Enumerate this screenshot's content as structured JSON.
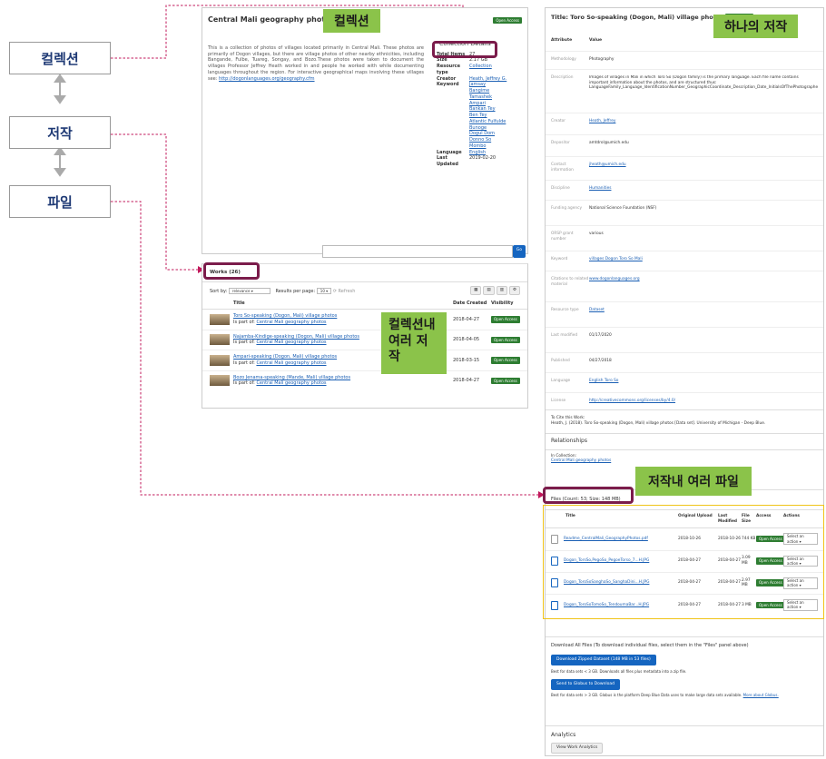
{
  "labels": {
    "left_collection": "컬렉션",
    "left_work": "저작",
    "left_file": "파일",
    "tag_collection": "컬렉션",
    "tag_single_work": "하나의 저작",
    "tag_works_in_collection": "컬렉션내 여러 저작",
    "tag_files_in_work": "저작내 여러 파일"
  },
  "collection": {
    "title": "Central Mali geography photos",
    "badge": "Open Access",
    "description": "This is a collection of photos of villages located primarily in Central Mali. These photos are primarily of Dogon villages, but there are village photos of other nearby ethnicities, including Bangande, Fulbe, Tuareg, Songay, and Bozo.These photos were taken to document the villages Professor Jeffrey Heath worked in and people he worked with while documenting languages throughout the region. For interactive geographical maps involving these villages see:",
    "description_link": "http://dogonlanguages.org/geography.cfm",
    "details_title": "Collection Details",
    "details": {
      "total_items_k": "Total Items",
      "total_items_v": "27",
      "size_k": "Size",
      "size_v": "2.17 GB",
      "rtype_k": "Resource type",
      "rtype_v": "Collection",
      "creator_k": "Creator",
      "creator_v": "Heath, Jeffrey G.",
      "keyword_k": "Keyword",
      "keywords": [
        "Jamsay",
        "Bangime",
        "Tamashek",
        "Ampari",
        "Bankan Tey",
        "Ben Tey",
        "Atlantic Fulfulde",
        "Bunoge",
        "Dogul Dom",
        "Donno So",
        "Mombo"
      ],
      "language_k": "Language",
      "language_v": "English",
      "updated_k": "Last Updated",
      "updated_v": "2019-02-20"
    },
    "search_btn": "Go",
    "works_header": "Works (26)",
    "sort_label": "Sort by:",
    "sort_value": "relevance",
    "rpp_label": "Results per page:",
    "rpp_value": "10",
    "refresh": "Refresh",
    "cols": {
      "title": "Title",
      "date": "Date Created",
      "vis": "Visibility"
    },
    "part_of": "Is part of:",
    "works": [
      {
        "title": "Toro So-speaking (Dogon, Mali) village photos",
        "parent": "Central Mali geography photos",
        "date": "2018-04-27",
        "vis": "Open Access"
      },
      {
        "title": "Najamba-Kindige-speaking (Dogon, Mali) village photos",
        "parent": "Central Mali geography photos",
        "date": "2018-04-05",
        "vis": "Open Access"
      },
      {
        "title": "Ampari-speaking (Dogon, Mali) village photos",
        "parent": "Central Mali geography photos",
        "date": "2018-03-15",
        "vis": "Open Access"
      },
      {
        "title": "Bozo Jenama-speaking (Mande, Mali) village photos",
        "parent": "Central Mali geography photos",
        "date": "2018-04-27",
        "vis": "Open Access"
      }
    ]
  },
  "work": {
    "title": "Title: Toro So-speaking (Dogon, Mali) village photos",
    "badge": "Open Access",
    "attr_h": "Attribute",
    "value_h": "Value",
    "rows": [
      {
        "k": "Methodology",
        "v": "Photography"
      },
      {
        "k": "Description",
        "v": "Images of villages in Mali in which Toro So (Dogon family) is the primary language. Each file name contains important information about the photos, and are structured thus: LanguageFamily_Language_IdentificationNumber_GeographicCoordinate_Description_Date_InitialsOfThePhotographer"
      },
      {
        "k": "Creator",
        "v": "Heath, Jeffrey"
      },
      {
        "k": "Depositor",
        "v": "amtdrol@umich.edu"
      },
      {
        "k": "Contact information",
        "v": "jheath@umich.edu"
      },
      {
        "k": "Discipline",
        "v": "Humanities"
      },
      {
        "k": "Funding agency",
        "v": "National Science Foundation (NSF)"
      },
      {
        "k": "ORSP grant number",
        "v": "various"
      },
      {
        "k": "Keyword",
        "v": "villages  Dogon  Toro So  Mali"
      },
      {
        "k": "Citations to related material",
        "v": "www.dogonlanguages.org"
      },
      {
        "k": "Resource type",
        "v": "Dataset"
      },
      {
        "k": "Last modified",
        "v": "01/17/2020"
      },
      {
        "k": "Published",
        "v": "04/27/2018"
      },
      {
        "k": "Language",
        "v": "English  Toro So"
      },
      {
        "k": "License",
        "v": "http://creativecommons.org/licenses/by/4.0/"
      }
    ],
    "cite_title": "To Cite this Work:",
    "cite_text": "Heath, J. (2018). Toro So-speaking (Dogon, Mali) village photos [Data set]. University of Michigan - Deep Blue.",
    "relationships": "Relationships",
    "in_collection": "In Collection:",
    "in_collection_link": "Central Mali geography photos",
    "files_header": "Files (Count: 53; Size: 148 MB)",
    "fcols": {
      "title": "Title",
      "upload": "Original Upload",
      "modified": "Last Modified",
      "size": "File Size",
      "access": "Access",
      "actions": "Actions"
    },
    "files": [
      {
        "name": "Readme_CentralMali_GeographyPhotos.pdf",
        "upload": "2018-10-26",
        "mod": "2018-10-26",
        "size": "744 KB",
        "access": "Open Access",
        "action": "Select an action"
      },
      {
        "name": "Dogon_TorsSo,PegoSo_PegoeTorso_7...H.JPG",
        "upload": "2018-04-27",
        "mod": "2018-04-27",
        "size": "3.09 MB",
        "access": "Open Access",
        "action": "Select an action"
      },
      {
        "name": "Dogon_ToroSoSanghaSo_SanghaDini...H.JPG",
        "upload": "2018-04-27",
        "mod": "2018-04-27",
        "size": "2.97 MB",
        "access": "Open Access",
        "action": "Select an action"
      },
      {
        "name": "Dogon_ToroSoTomoSo_TendoumaBar...H.JPG",
        "upload": "2018-04-27",
        "mod": "2018-04-27",
        "size": "3 MB",
        "access": "Open Access",
        "action": "Select an action"
      }
    ],
    "download_title": "Download All Files (To download individual files, select them in the \"Files\" panel above)",
    "download_btn": "Download Zipped Dataset (148 MB in 53 files)",
    "download_note": "Best for data sets < 3 GB. Downloads all files plus metadata into a zip file.",
    "globus_btn": "Send to Globus to Download",
    "globus_note": "Best for data sets > 3 GB. Globus is the platform Deep Blue Data uses to make large data sets available.",
    "globus_link": "More about Globus.",
    "analytics": "Analytics",
    "analytics_btn": "View Work Analytics"
  }
}
